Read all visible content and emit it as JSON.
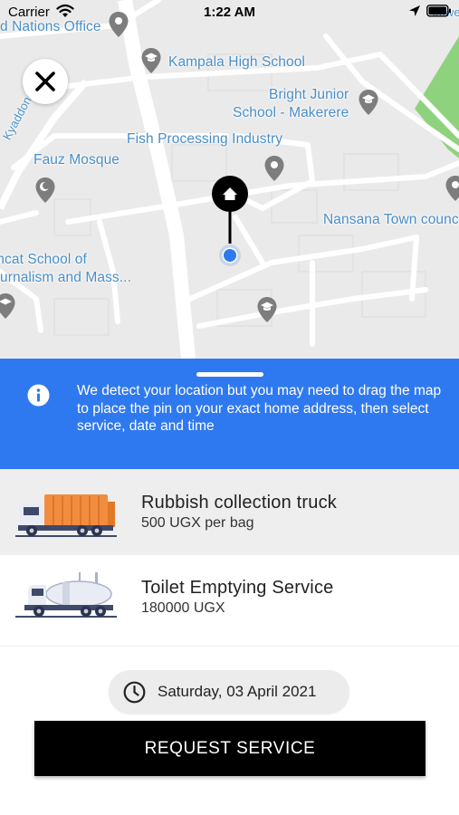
{
  "status_bar": {
    "carrier": "Carrier",
    "time": "1:22 AM"
  },
  "map": {
    "labels": {
      "office": "d Nations Office",
      "kampala_high": "Kampala High School",
      "bright_junior_1": "Bright Junior",
      "bright_junior_2": "School - Makerere",
      "fish": "Fish Processing Industry",
      "fauz": "Fauz Mosque",
      "nansana": "Nansana Town counc",
      "kyaddondo": "Kyaddondo",
      "umcat_1": "mcat School of",
      "umcat_2": "urnalism and Mass...",
      "top_right": "Jewel"
    },
    "colors": {
      "background": "#eaeaea",
      "road": "#ffffff",
      "label": "#4a8ec6",
      "park": "#8fd27e",
      "poi": "#7d7d7d",
      "location_dot": "#2f79f0"
    }
  },
  "info_banner": {
    "text": "We detect your location but you may need to drag the map to place the pin on your exact home address, then select service, date and time",
    "background": "#2f79f0"
  },
  "services": [
    {
      "name": "Rubbish collection truck",
      "price": "500 UGX per bag",
      "selected": true
    },
    {
      "name": "Toilet Emptying Service",
      "price": "180000 UGX",
      "selected": false
    }
  ],
  "date": {
    "value": "Saturday, 03 April 2021"
  },
  "request_button": {
    "label": "REQUEST SERVICE"
  },
  "icons": [
    "close-icon",
    "info-icon",
    "clock-icon",
    "home-icon",
    "wifi-icon",
    "location-arrow-icon",
    "battery-icon",
    "map-poi-icon",
    "school-icon"
  ]
}
